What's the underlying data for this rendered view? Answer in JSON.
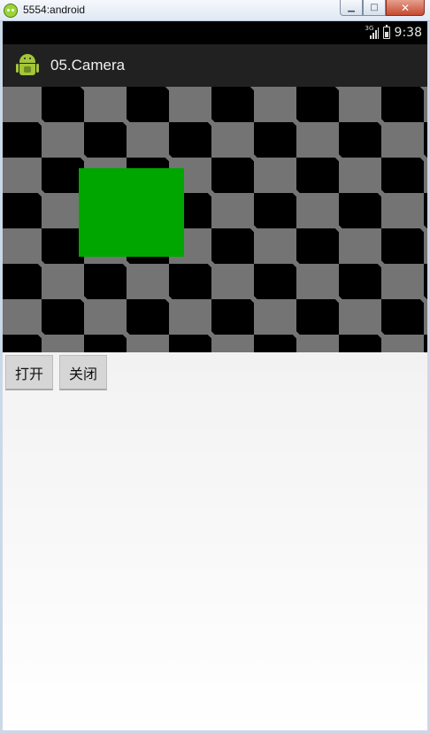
{
  "window": {
    "title": "5554:android",
    "controls": [
      "minimize",
      "maximize",
      "close"
    ]
  },
  "status_bar": {
    "network": "3G",
    "time": "9:38"
  },
  "action_bar": {
    "title": "05.Camera"
  },
  "camera_preview": {
    "pattern_colors": [
      "#000000",
      "#747474"
    ],
    "overlay_color": "#00a600"
  },
  "buttons": {
    "open_label": "打开",
    "close_label": "关闭"
  },
  "icons": {
    "window": "emulator-app-icon",
    "signal": "signal-icon",
    "battery": "battery-icon",
    "app": "android-robot-icon"
  }
}
